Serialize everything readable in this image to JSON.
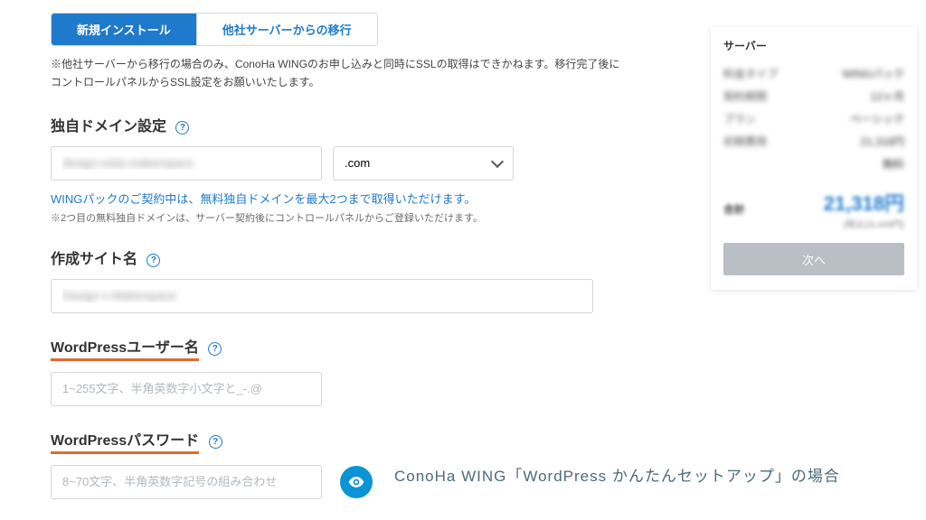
{
  "tabs": {
    "new_install": "新規インストール",
    "migration": "他社サーバーからの移行"
  },
  "migration_note": "他社サーバーから移行の場合のみ、ConoHa WINGのお申し込みと同時にSSLの取得はできかねます。移行完了後にコントロールパネルからSSL設定をお願いいたします。",
  "domain": {
    "title": "独自ドメイン設定",
    "value": "design-vista-makerspace",
    "tld": ".com",
    "link": "WINGパックのご契約中は、無料独自ドメインを最大2つまで取得いただけます。",
    "note": "2つ目の無料独自ドメインは、サーバー契約後にコントロールパネルからご登録いただけます。"
  },
  "site": {
    "title": "作成サイト名",
    "value": "Design n Makerspace"
  },
  "wp_user": {
    "title": "WordPressユーザー名",
    "placeholder": "1~255文字、半角英数字小文字と_-.@"
  },
  "wp_pass": {
    "title": "WordPressパスワード",
    "placeholder": "8~70文字、半角英数字記号の組み合わせ"
  },
  "sidebar": {
    "header": "サーバー",
    "rows": [
      {
        "label": "料金タイプ",
        "value": "WINGパック"
      },
      {
        "label": "契約期間",
        "value": "12ヶ月"
      },
      {
        "label": "プラン",
        "value": "ベーシック"
      },
      {
        "label": "初期費用",
        "value": "21,318円"
      },
      {
        "label": "",
        "value": "無料"
      }
    ],
    "total_label": "合計",
    "total_amount": "21,318円",
    "total_sub": "(税込23,449円)",
    "next": "次へ"
  },
  "caption": "ConoHa WING「WordPress かんたんセットアップ」の場合"
}
